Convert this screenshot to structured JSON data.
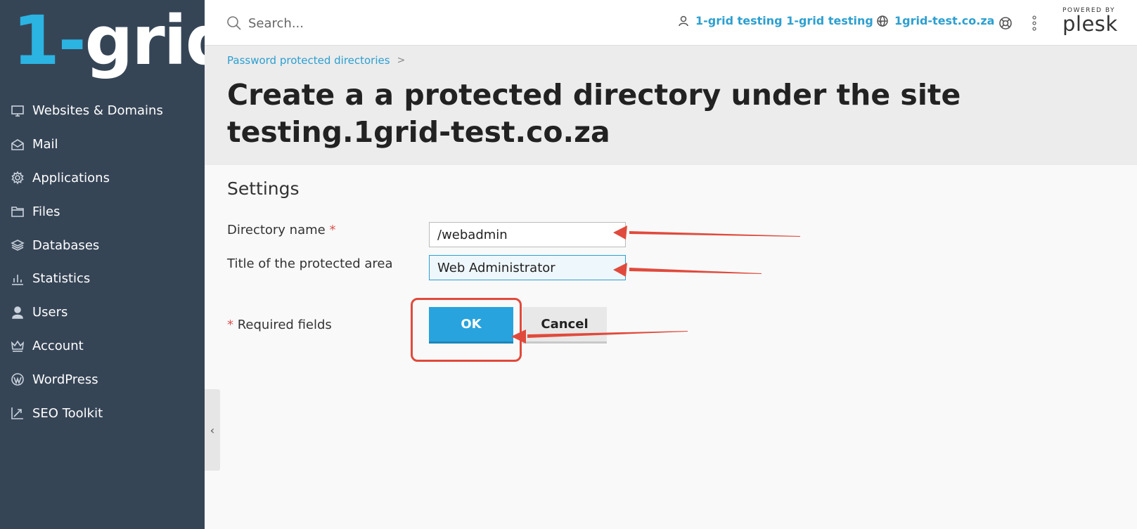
{
  "brand": {
    "logo_one": "1",
    "logo_dash": "-",
    "logo_rest": "grid"
  },
  "sidebar": {
    "items": [
      {
        "label": "Websites & Domains",
        "icon": "monitor-icon"
      },
      {
        "label": "Mail",
        "icon": "mail-icon"
      },
      {
        "label": "Applications",
        "icon": "gear-icon"
      },
      {
        "label": "Files",
        "icon": "folder-icon"
      },
      {
        "label": "Databases",
        "icon": "layers-icon"
      },
      {
        "label": "Statistics",
        "icon": "bar-chart-icon"
      },
      {
        "label": "Users",
        "icon": "user-icon"
      },
      {
        "label": "Account",
        "icon": "crown-icon"
      },
      {
        "label": "WordPress",
        "icon": "wordpress-icon"
      },
      {
        "label": "SEO Toolkit",
        "icon": "chart-up-icon"
      }
    ]
  },
  "topbar": {
    "search_placeholder": "Search...",
    "user_label": "1-grid testing 1-grid testing",
    "domain_label": "1grid-test.co.za",
    "powered_by": "POWERED BY",
    "plesk": "plesk"
  },
  "header": {
    "breadcrumb": "Password protected directories",
    "breadcrumb_sep": ">",
    "title": "Create a a protected directory under the site testing.1grid-test.co.za"
  },
  "form": {
    "section_title": "Settings",
    "directory_label": "Directory name",
    "directory_value": "/webadmin",
    "title_label": "Title of the protected area",
    "title_value": "Web Administrator",
    "required_star": "*",
    "required_note": "Required fields",
    "ok_label": "OK",
    "cancel_label": "Cancel"
  },
  "colors": {
    "sidebar_bg": "#364556",
    "accent": "#28a3dd",
    "link": "#2c9fd0",
    "annotation_red": "#e04a3c"
  }
}
